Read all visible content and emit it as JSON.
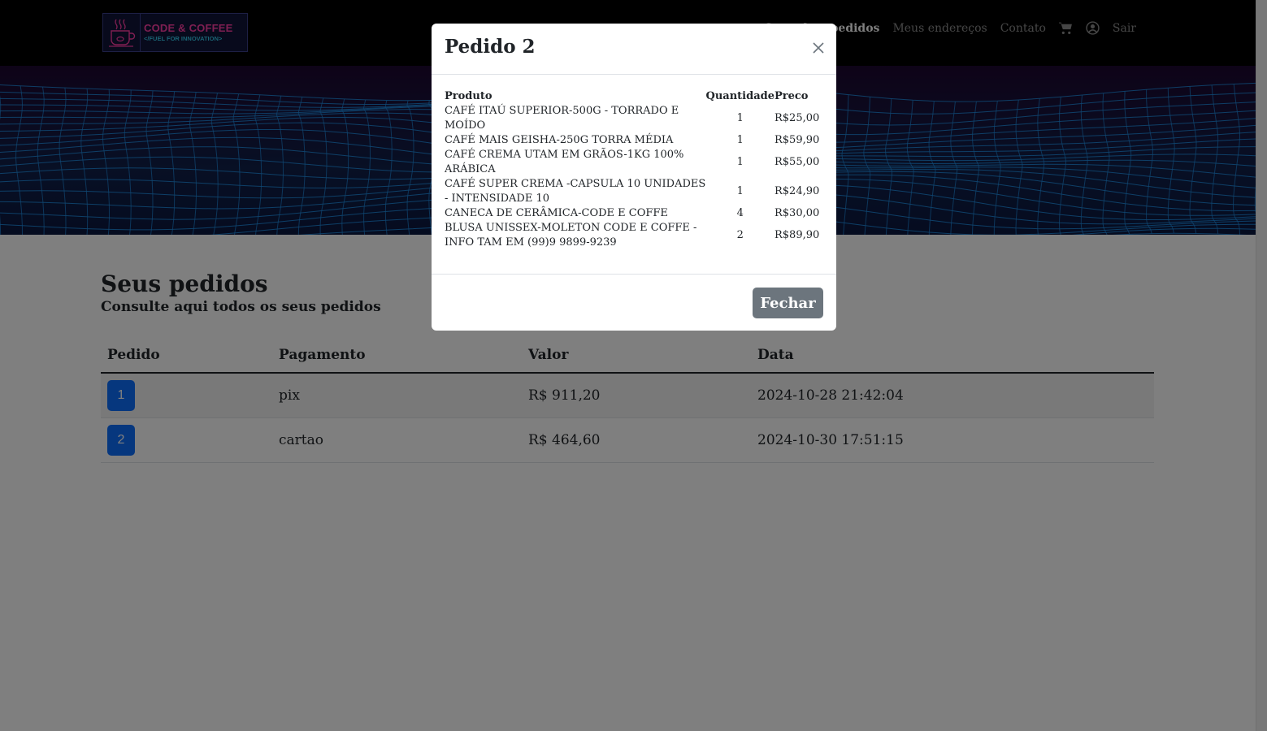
{
  "brand": {
    "logo_title": "CODE & COFFEE",
    "logo_subtitle": "</FUEL FOR INNOVATION>",
    "colors": {
      "pink": "#ff3ea5",
      "cyan": "#34c6e6"
    }
  },
  "nav": {
    "links": [
      {
        "label": "Consultar pedidos",
        "active": true
      },
      {
        "label": "Meus endereços",
        "active": false
      },
      {
        "label": "Contato",
        "active": false
      }
    ],
    "cart_icon": "cart-icon",
    "user_icon": "user-circle-icon",
    "logout_label": "Sair"
  },
  "page": {
    "title": "Seus pedidos",
    "subtitle": "Consulte aqui todos os seus pedidos"
  },
  "orders_table": {
    "headers": [
      "Pedido",
      "Pagamento",
      "Valor",
      "Data"
    ],
    "rows": [
      {
        "id": "1",
        "payment": "pix",
        "value": "R$ 911,20",
        "date": "2024-10-28 21:42:04"
      },
      {
        "id": "2",
        "payment": "cartao",
        "value": "R$ 464,60",
        "date": "2024-10-30 17:51:15"
      }
    ]
  },
  "modal": {
    "title": "Pedido 2",
    "headers": {
      "product": "Produto",
      "quantity": "Quantidade",
      "price": "Preco"
    },
    "items": [
      {
        "product": "CAFÉ ITAÚ SUPERIOR-500G - TORRADO E MOÍDO",
        "quantity": "1",
        "price": "R$25,00"
      },
      {
        "product": "CAFÉ MAIS GEISHA-250G TORRA MÉDIA",
        "quantity": "1",
        "price": "R$59,90"
      },
      {
        "product": "CAFÉ CREMA UTAM EM GRÃOS-1KG 100% ARÁBICA",
        "quantity": "1",
        "price": "R$55,00"
      },
      {
        "product": "CAFÉ SUPER CREMA -CAPSULA 10 UNIDADES - INTENSIDADE 10",
        "quantity": "1",
        "price": "R$24,90"
      },
      {
        "product": "CANECA DE CERÂMICA-CODE E COFFE",
        "quantity": "4",
        "price": "R$30,00"
      },
      {
        "product": "BLUSA UNISSEX-MOLETON CODE E COFFE - INFO TAM EM (99)9 9899-9239",
        "quantity": "2",
        "price": "R$89,90"
      }
    ],
    "close_label": "Fechar",
    "close_icon": "close-icon"
  }
}
